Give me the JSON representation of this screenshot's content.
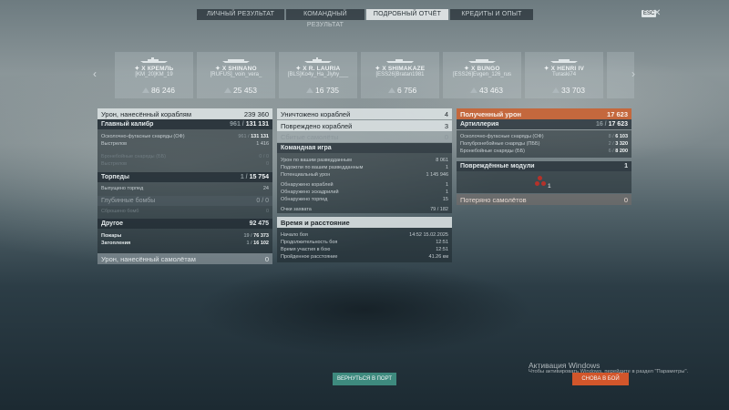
{
  "tabs": [
    {
      "label": "ЛИЧНЫЙ РЕЗУЛЬТАТ"
    },
    {
      "label": "КОМАНДНЫЙ РЕЗУЛЬТАТ"
    },
    {
      "label": "ПОДРОБНЫЙ ОТЧЁТ",
      "active": true
    },
    {
      "label": "КРЕДИТЫ И ОПЫТ"
    }
  ],
  "esc_label": "ESC",
  "close_glyph": "✕",
  "nav": {
    "prev": "‹",
    "next": "›"
  },
  "ships": [
    {
      "name": "✦ X КРЕМЛЬ",
      "player": "[KM_20]KM_19",
      "damage": "86 246"
    },
    {
      "name": "✦ X SHINANO",
      "player": "[RUFUS]_voin_vera_",
      "damage": "25 453"
    },
    {
      "name": "✦ X R. LAURIA",
      "player": "[BLS]Ko4y_Ha_Jlyhy___",
      "damage": "16 735"
    },
    {
      "name": "✦ X SHIMAKAZE",
      "player": "[ESS26]Bratan1981",
      "damage": "6 756"
    },
    {
      "name": "✦ X BUNGO",
      "player": "[ESS26]Evgen_126_rus",
      "damage": "43 463"
    },
    {
      "name": "✦ X HENRI IV",
      "player": "Turaski74",
      "damage": "33 703"
    }
  ],
  "left": {
    "damage_header": {
      "label": "Урон, нанесённый кораблям",
      "value": "239 360"
    },
    "main_caliber": {
      "label": "Главный калибр",
      "value_muted": "961 /",
      "value": "131 131"
    },
    "he_shells": {
      "label": "Осколочно-фугасные снаряды (ОФ)",
      "value_muted": "961 /",
      "value": "131 131"
    },
    "shots": {
      "label": "Выстрелов",
      "value": "1 416"
    },
    "ap_shells": {
      "label": "Бронебойные снаряды (ББ)",
      "value": "0 / 0"
    },
    "ap_shots": {
      "label": "Выстрелов",
      "value": "0"
    },
    "torpedoes": {
      "label": "Торпеды",
      "value_muted": "1 /",
      "value": "15 754"
    },
    "torp_launched": {
      "label": "Выпущено торпед",
      "value": "24"
    },
    "depth_charges": {
      "label": "Глубинные бомбы",
      "value": "0 / 0"
    },
    "bombs_dropped": {
      "label": "Сброшено бомб",
      "value": "0"
    },
    "other": {
      "label": "Другое",
      "value": "92 475"
    },
    "fires": {
      "label": "Пожары",
      "value_muted": "19 /",
      "value": "76 373"
    },
    "flooding": {
      "label": "Затопления",
      "value_muted": "1 /",
      "value": "16 102"
    },
    "plane_damage": {
      "label": "Урон, нанесённый самолётам",
      "value": "0"
    }
  },
  "middle": {
    "ships_destroyed": {
      "label": "Уничтожено кораблей",
      "value": "4"
    },
    "ships_damaged": {
      "label": "Повреждено кораблей",
      "value": "3"
    },
    "planes_shot": {
      "label": "Сбитые самолёты",
      "value": "0"
    },
    "team_play": {
      "label": "Командная игра"
    },
    "spot_damage": {
      "label": "Урон по вашим разведданным",
      "value": "8 061"
    },
    "spot_fires": {
      "label": "Подожгли по вашим разведданным",
      "value": "1"
    },
    "potential": {
      "label": "Потенциальный урон",
      "value": "1 145 946"
    },
    "spotted_ships": {
      "label": "Обнаружено кораблей",
      "value": "1"
    },
    "spotted_squads": {
      "label": "Обнаружено эскадрилий",
      "value": "1"
    },
    "spotted_torps": {
      "label": "Обнаружено торпед",
      "value": "15"
    },
    "capture_pts": {
      "label": "Очки захвата",
      "value": "79 / 182"
    },
    "time_header": {
      "label": "Время и расстояние"
    },
    "start": {
      "label": "Начало боя",
      "value": "14:52  15.02.2025"
    },
    "duration": {
      "label": "Продолжительность боя",
      "value": "12:51"
    },
    "participation": {
      "label": "Время участия в бою",
      "value": "12:51"
    },
    "distance": {
      "label": "Пройденное расстояние",
      "value": "41.26 км"
    }
  },
  "right": {
    "received": {
      "label": "Полученный урон",
      "value": "17 623"
    },
    "artillery": {
      "label": "Артиллерия",
      "value_muted": "16 /",
      "value": "17 623"
    },
    "he": {
      "label": "Осколочно-фугасные снаряды (ОФ)",
      "value_muted": "8 /",
      "value": "6 103"
    },
    "sap": {
      "label": "Полубронебойные снаряды (ПББ)",
      "value_muted": "2 /",
      "value": "3 320"
    },
    "ap": {
      "label": "Бронебойные снаряды (ББ)",
      "value_muted": "6 /",
      "value": "8 200"
    },
    "modules": {
      "label": "Повреждённые модули",
      "value": "1"
    },
    "module_count": "1",
    "planes_lost": {
      "label": "Потеряно самолётов",
      "value": "0"
    }
  },
  "buttons": {
    "port": "ВЕРНУТЬСЯ В ПОРТ",
    "battle": "СНОВА В БОЙ"
  },
  "watermark": {
    "title": "Активация Windows",
    "text": "Чтобы активировать Windows, перейдите в раздел \"Параметры\"."
  },
  "colors": {
    "accent_orange": "#c4683d",
    "port_button": "#3e8a7e",
    "battle_button": "#d2562b"
  }
}
